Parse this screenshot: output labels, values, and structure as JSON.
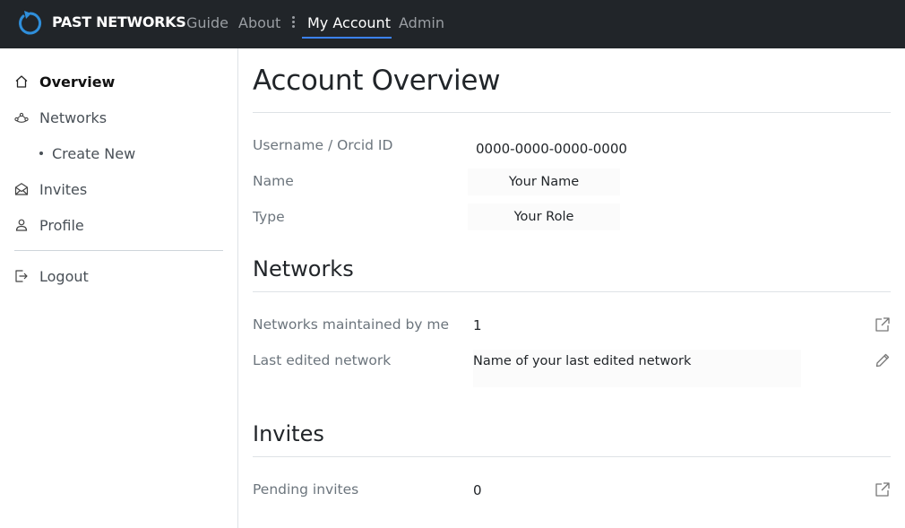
{
  "header": {
    "brand": "PAST NETWORKS",
    "nav": {
      "guide": "Guide",
      "about": "About",
      "my_account": "My Account",
      "admin": "Admin"
    },
    "active_tab": "My Account",
    "accent_color": "#3b82f6"
  },
  "sidebar": {
    "items": [
      {
        "label": "Overview",
        "icon": "home-icon",
        "active": true
      },
      {
        "label": "Networks",
        "icon": "network-icon"
      },
      {
        "label": "Create New",
        "icon": "bullet"
      },
      {
        "label": "Invites",
        "icon": "envelope-icon"
      },
      {
        "label": "Profile",
        "icon": "person-icon"
      },
      {
        "label": "Logout",
        "icon": "logout-icon"
      }
    ]
  },
  "main": {
    "title": "Account Overview",
    "account": {
      "username_label": "Username / Orcid ID",
      "username_value": "0000-0000-0000-0000",
      "name_label": "Name",
      "name_value": "Your Name",
      "type_label": "Type",
      "type_value": "Your Role"
    },
    "networks": {
      "title": "Networks",
      "maintained_label": "Networks maintained by me",
      "maintained_value": "1",
      "last_edited_label": "Last edited network",
      "last_edited_value": "Name of your last edited network"
    },
    "invites": {
      "title": "Invites",
      "pending_label": "Pending invites",
      "pending_value": "0"
    }
  }
}
